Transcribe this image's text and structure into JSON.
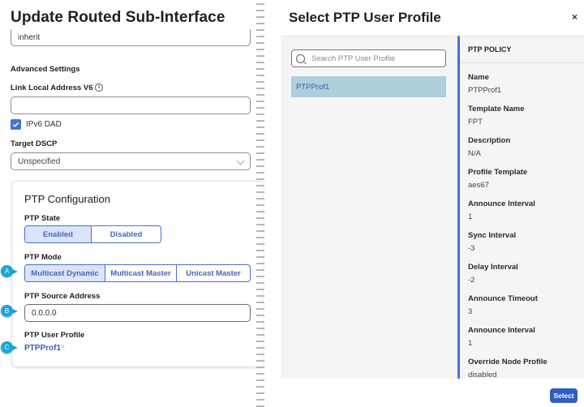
{
  "left_panel": {
    "title": "Update Routed Sub-Interface",
    "inherit_value": "inherit",
    "advanced_settings_label": "Advanced Settings",
    "link_local_label": "Link Local Address V6",
    "link_local_value": "",
    "ipv6_dad": {
      "label": "IPv6 DAD",
      "checked": true
    },
    "target_dscp": {
      "label": "Target DSCP",
      "value": "Unspecified"
    },
    "ptp": {
      "title": "PTP Configuration",
      "state_label": "PTP State",
      "state_options": [
        "Enabled",
        "Disabled"
      ],
      "state_selected": "Enabled",
      "mode_label": "PTP Mode",
      "mode_options": [
        "Multicast Dynamic",
        "Multicast Master",
        "Unicast Master"
      ],
      "mode_selected": "Multicast Dynamic",
      "source_label": "PTP Source Address",
      "source_value": "0.0.0.0",
      "profile_label": "PTP User Profile",
      "profile_value": "PTPProf1",
      "profile_clear": "×"
    },
    "callouts": [
      "A",
      "B",
      "C"
    ]
  },
  "modal": {
    "title": "Select PTP User Profile",
    "close": "×",
    "search_placeholder": "Search PTP User Profile",
    "list": [
      "PTPProf1"
    ],
    "selected": "PTPProf1",
    "policy_header": "PTP POLICY",
    "fields": [
      {
        "key": "Name",
        "value": "PTPProf1"
      },
      {
        "key": "Template Name",
        "value": "FPT"
      },
      {
        "key": "Description",
        "value": "N/A"
      },
      {
        "key": "Profile Template",
        "value": "aes67"
      },
      {
        "key": "Announce Interval",
        "value": "1"
      },
      {
        "key": "Sync Interval",
        "value": "-3"
      },
      {
        "key": "Delay Interval",
        "value": "-2"
      },
      {
        "key": "Announce Timeout",
        "value": "3"
      },
      {
        "key": "Announce Interval",
        "value": "1"
      },
      {
        "key": "Override Node Profile",
        "value": "disabled"
      }
    ],
    "select_button": "Select"
  },
  "colors": {
    "accent": "#4a6fd1",
    "callout": "#1ba6d9",
    "selected_row": "#aecfdc",
    "primary_button": "#2f5fc4"
  }
}
